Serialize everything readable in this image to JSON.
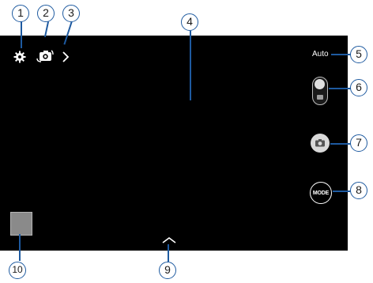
{
  "camera": {
    "mode_indicator": "Auto",
    "mode_button_label": "MODE"
  },
  "callouts": [
    "1",
    "2",
    "3",
    "4",
    "5",
    "6",
    "7",
    "8",
    "9",
    "10"
  ],
  "icons": {
    "settings": "gear-icon",
    "switch_camera": "switch-camera-icon",
    "expand": "chevron-right-icon",
    "mode_toggle": "camera-video-toggle-icon",
    "capture": "camera-icon",
    "show_more": "chevron-up-icon"
  },
  "colors": {
    "viewfinder": "#000000",
    "callout_border": "#1e5aa0",
    "thumbnail": "#8a8a8a"
  }
}
